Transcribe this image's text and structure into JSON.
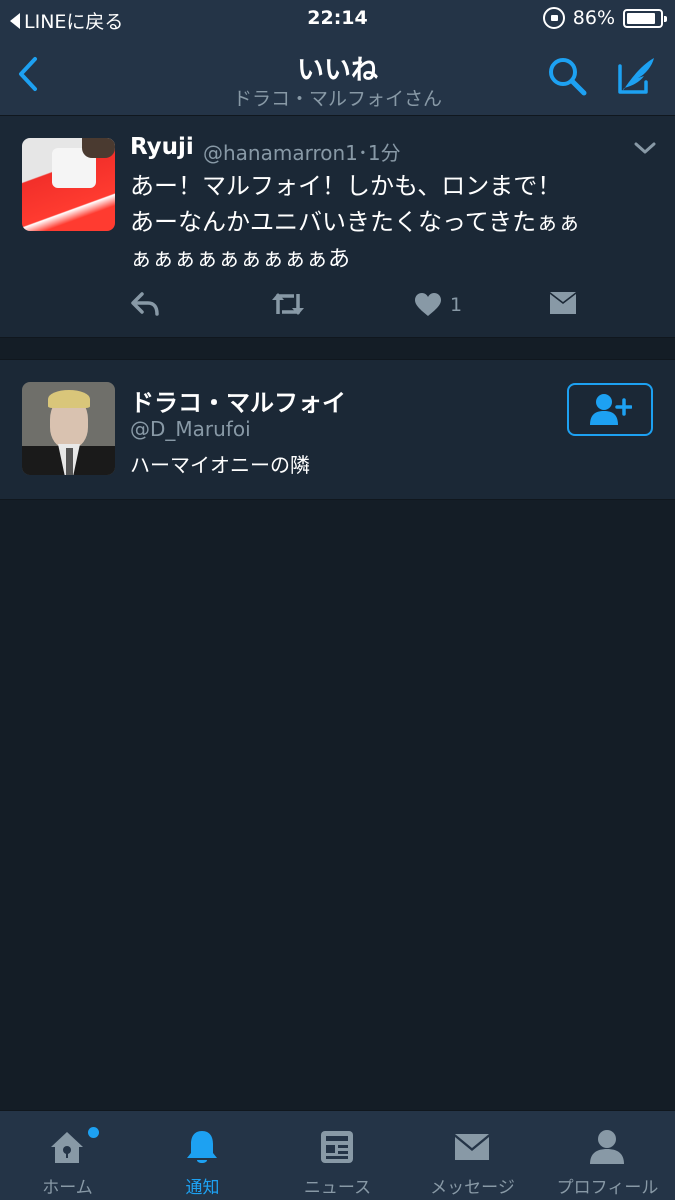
{
  "status_bar": {
    "back_label": "LINEに戻る",
    "time": "22:14",
    "battery": "86%",
    "battery_level": 0.86
  },
  "nav": {
    "title": "いいね",
    "subtitle": "ドラコ・マルフォイさん"
  },
  "tweet": {
    "name": "Ryuji",
    "handle_time": "@hanamarron1･1分",
    "line1": "あー！マルフォイ！しかも、ロンまで！",
    "line2_main": "あーなんかユニバいきたくなってきた",
    "line2_small": "ぁぁ",
    "line3": "ぁぁぁぁぁぁぁぁぁあ",
    "like_count": "1"
  },
  "user": {
    "name": "ドラコ・マルフォイ",
    "handle": "@D_Marufoi",
    "bio": "ハーマイオニーの隣"
  },
  "tabs": [
    {
      "label": "ホーム",
      "icon": "home-icon"
    },
    {
      "label": "通知",
      "icon": "bell-icon"
    },
    {
      "label": "ニュース",
      "icon": "news-icon"
    },
    {
      "label": "メッセージ",
      "icon": "envelope-icon"
    },
    {
      "label": "プロフィール",
      "icon": "person-icon"
    }
  ],
  "colors": {
    "accent": "#1da1f2",
    "background": "#141d26",
    "card": "#1b2836",
    "bar": "#243447",
    "secondary_text": "#8899a6"
  }
}
